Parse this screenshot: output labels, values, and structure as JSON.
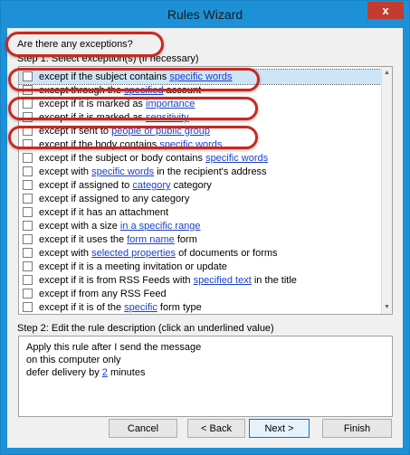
{
  "window": {
    "title": "Rules Wizard",
    "close_label": "x"
  },
  "main": {
    "question": "Are there any exceptions?",
    "step1_label": "Step 1: Select exception(s) (if necessary)",
    "step2_label": "Step 2: Edit the rule description (click an underlined value)"
  },
  "exceptions": [
    {
      "pre": "except if the subject contains ",
      "link": "specific words",
      "post": ""
    },
    {
      "pre": "except through the ",
      "link": "specified",
      "post": " account"
    },
    {
      "pre": "except if it is marked as ",
      "link": "importance",
      "post": ""
    },
    {
      "pre": "except if it is marked as ",
      "link": "sensitivity",
      "post": ""
    },
    {
      "pre": "except if sent to ",
      "link": "people or public group",
      "post": ""
    },
    {
      "pre": "except if the body contains ",
      "link": "specific words",
      "post": ""
    },
    {
      "pre": "except if the subject or body contains ",
      "link": "specific words",
      "post": ""
    },
    {
      "pre": "except with ",
      "link": "specific words",
      "post": " in the recipient's address"
    },
    {
      "pre": "except if assigned to ",
      "link": "category",
      "post": " category"
    },
    {
      "pre": "except if assigned to any category",
      "link": "",
      "post": ""
    },
    {
      "pre": "except if it has an attachment",
      "link": "",
      "post": ""
    },
    {
      "pre": "except with a size ",
      "link": "in a specific range",
      "post": ""
    },
    {
      "pre": "except if it uses the ",
      "link": "form name",
      "post": " form"
    },
    {
      "pre": "except with ",
      "link": "selected properties",
      "post": " of documents or forms"
    },
    {
      "pre": "except if it is a meeting invitation or update",
      "link": "",
      "post": ""
    },
    {
      "pre": "except if it is from RSS Feeds with ",
      "link": "specified text",
      "post": " in the title"
    },
    {
      "pre": "except if from any RSS Feed",
      "link": "",
      "post": ""
    },
    {
      "pre": "except if it is of the ",
      "link": "specific",
      "post": " form type"
    }
  ],
  "description": {
    "line1": "Apply this rule after I send the message",
    "line2": "on this computer only",
    "line3_pre": "defer delivery by ",
    "line3_link": "2",
    "line3_post": " minutes"
  },
  "buttons": {
    "cancel": "Cancel",
    "back": "< Back",
    "next": "Next >",
    "finish": "Finish"
  }
}
